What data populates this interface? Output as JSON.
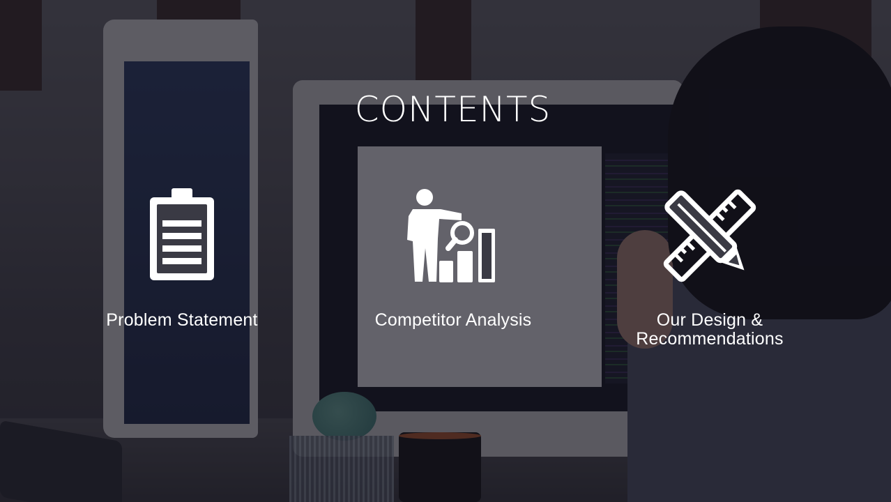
{
  "slide": {
    "title": "CONTENTS",
    "items": [
      {
        "label": "Problem Statement",
        "icon": "clipboard-icon"
      },
      {
        "label": "Competitor Analysis",
        "icon": "presenter-analysis-chart-icon"
      },
      {
        "label": "Our Design &\nRecommendations",
        "icon": "ruler-pencil-icon"
      }
    ]
  },
  "colors": {
    "text": "#ffffff",
    "overlay": "#12101c"
  }
}
